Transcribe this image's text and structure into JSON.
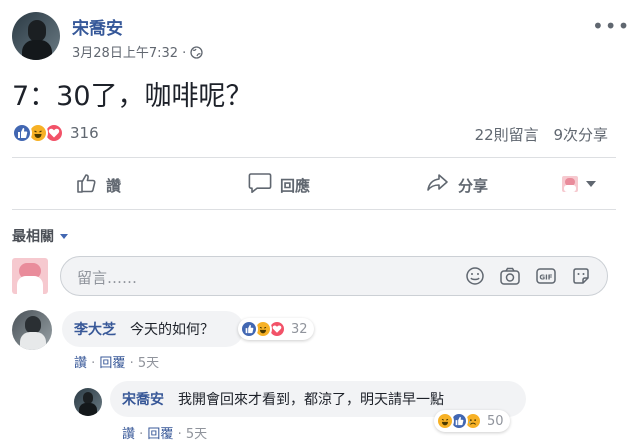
{
  "post": {
    "author": "宋喬安",
    "timestamp": "3月28日上午7:32 · ",
    "visibility_icon": "globe-icon",
    "text": "7：30了，咖啡呢？",
    "menu_icon": "more-options-icon"
  },
  "stats": {
    "reaction_count": "316",
    "comments": "22則留言",
    "shares": "9次分享"
  },
  "actions": {
    "like": "讚",
    "comment": "回應",
    "share": "分享"
  },
  "comments_section": {
    "sort_label": "最相關",
    "input_placeholder": "留言……"
  },
  "comments": [
    {
      "author": "李大芝",
      "text": "今天的如何？",
      "reaction_count": "32",
      "like": "讚",
      "reply": "回覆",
      "time": "5天"
    }
  ],
  "replies": [
    {
      "author": "宋喬安",
      "text": "我開會回來才看到，都涼了，明天請早一點",
      "reaction_count": "50",
      "like": "讚",
      "reply": "回覆",
      "time": "5天"
    }
  ],
  "colors": {
    "link_blue": "#365899",
    "facebook_blue": "#4267b2",
    "love_red": "#f25268",
    "haha_yellow": "#f7b125",
    "muted_gray": "#90949c"
  }
}
